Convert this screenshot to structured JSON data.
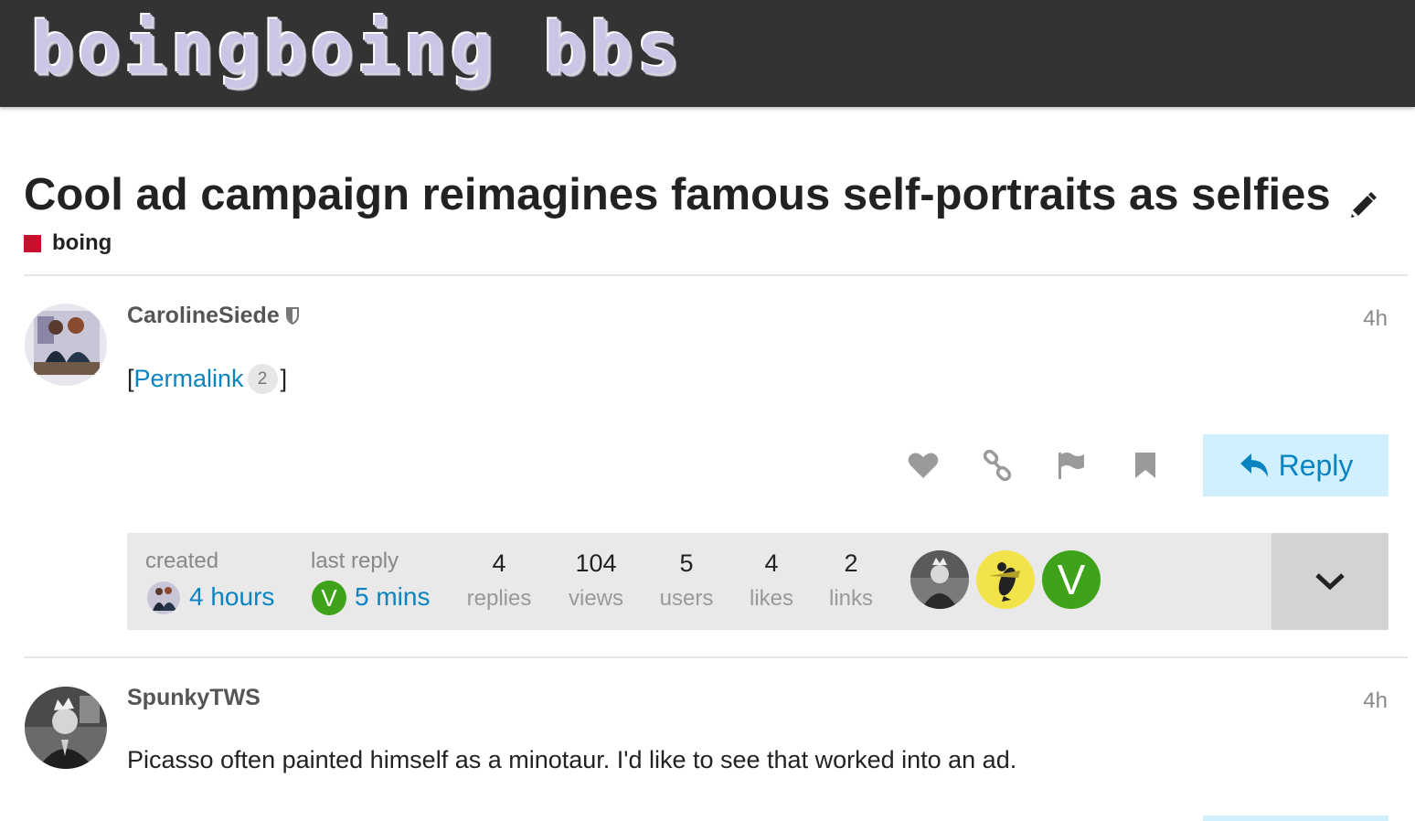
{
  "site": {
    "logo_text": "boingboing bbs"
  },
  "topic": {
    "title": "Cool ad campaign reimagines famous self-portraits as selfies",
    "category": {
      "name": "boing",
      "color": "#c8102e"
    }
  },
  "posts": [
    {
      "username": "CarolineSiede",
      "time": "4h",
      "permalink_open": "[",
      "permalink_label": "Permalink",
      "permalink_count": "2",
      "permalink_close": "]",
      "actions": {
        "like": "heart-icon",
        "share": "link-icon",
        "flag": "flag-icon",
        "bookmark": "bookmark-icon"
      },
      "reply_label": "Reply"
    },
    {
      "username": "SpunkyTWS",
      "time": "4h",
      "body": "Picasso often painted himself as a minotaur. I'd like to see that worked into an ad."
    }
  ],
  "topic_map": {
    "created_label": "created",
    "created_value": "4 hours",
    "last_reply_label": "last reply",
    "last_reply_value": "5 mins",
    "last_reply_avatar_letter": "V",
    "stats": [
      {
        "value": "4",
        "label": "replies"
      },
      {
        "value": "104",
        "label": "views"
      },
      {
        "value": "5",
        "label": "users"
      },
      {
        "value": "4",
        "label": "likes"
      },
      {
        "value": "2",
        "label": "links"
      }
    ],
    "participants": [
      "photo",
      "penguin",
      "V"
    ]
  },
  "colors": {
    "accent": "#0a84c1",
    "reply_bg": "#d1f0ff",
    "header_bg": "#333333",
    "v_avatar": "#3ea31a"
  }
}
